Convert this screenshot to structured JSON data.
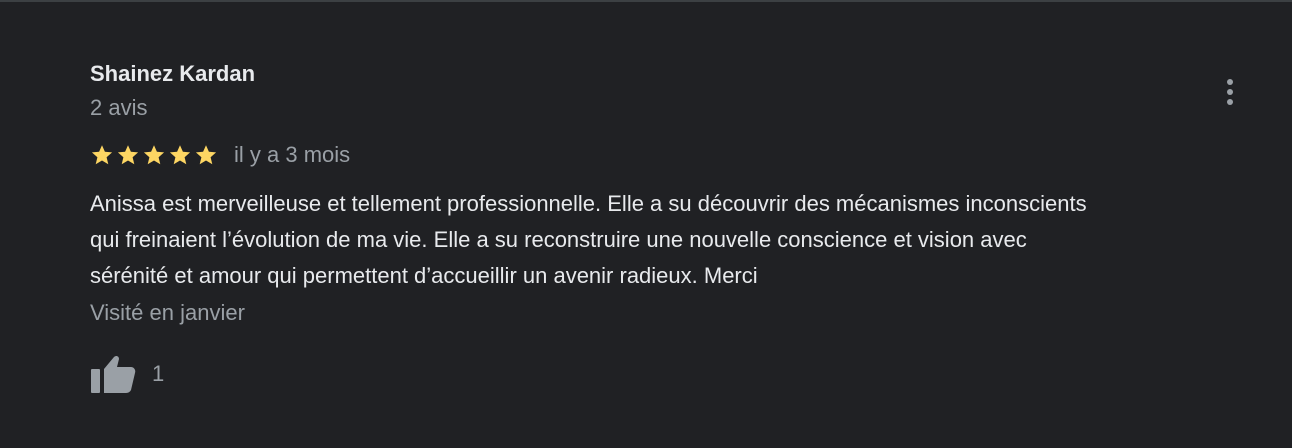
{
  "review": {
    "author_name": "Shainez Kardan",
    "author_meta": "2 avis",
    "rating": 5,
    "rating_max": 5,
    "time_ago": "il y a 3 mois",
    "text_lines": [
      "Anissa est merveilleuse et tellement professionnelle. Elle a su découvrir des mécanismes inconscients",
      "qui freinaient l’évolution de ma vie. Elle a su reconstruire une nouvelle conscience et vision avec",
      "sérénité et amour qui permettent d’accueillir un avenir radieux. Merci"
    ],
    "visited": "Visité en janvier",
    "like_count": "1"
  },
  "icons": {
    "star": "star-icon",
    "thumb": "thumb-up-icon",
    "more": "more-vert-icon"
  },
  "colors": {
    "background": "#202124",
    "star": "#fdd663",
    "primary_text": "#e8eaed",
    "secondary_text": "#9aa0a6"
  }
}
